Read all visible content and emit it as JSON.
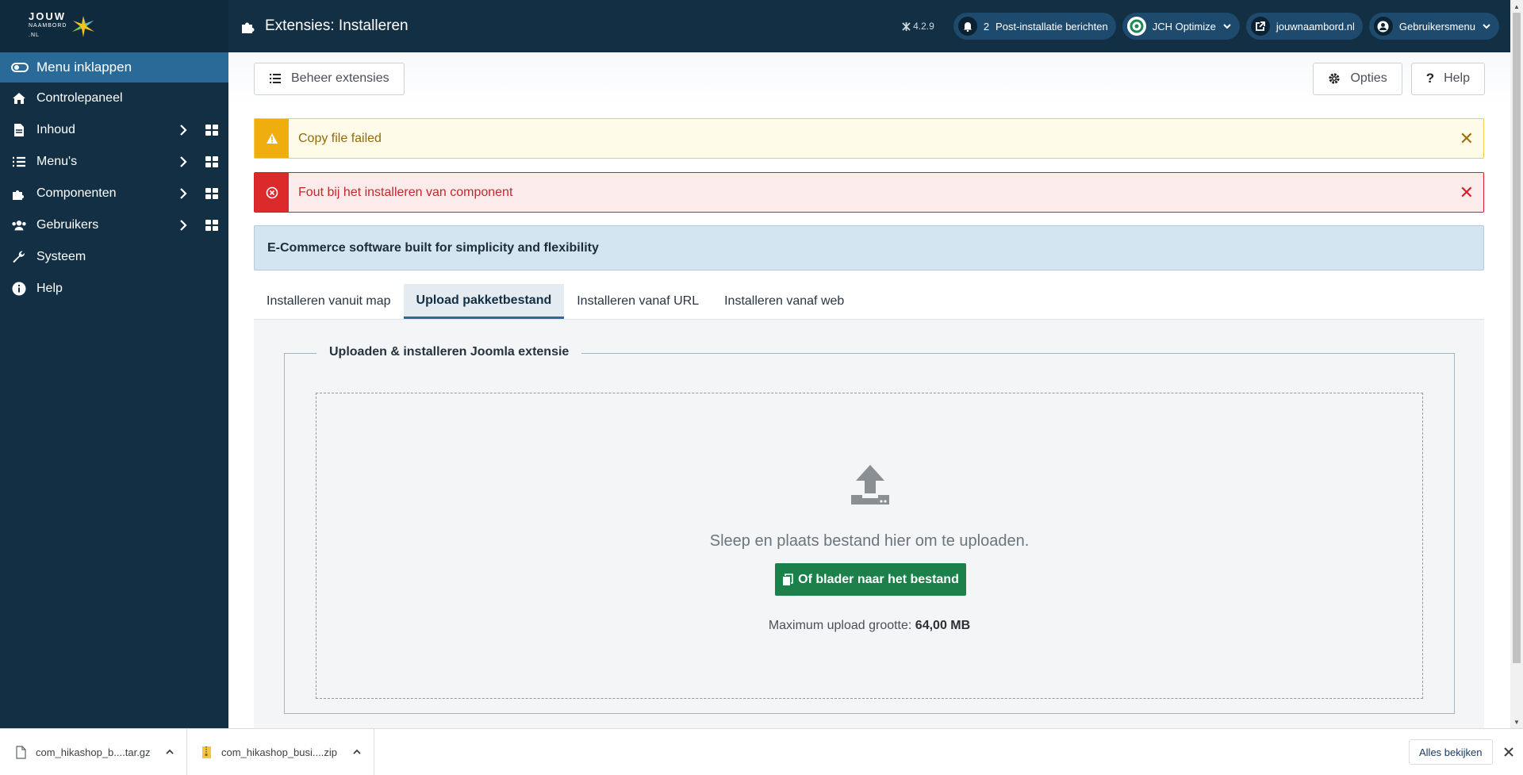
{
  "sidebar": {
    "logo": {
      "line1": "JOUW",
      "line2": "NAAMBORD",
      "line3": ".NL"
    },
    "toggle_label": "Menu inklappen",
    "items": [
      {
        "label": "Controlepaneel",
        "icon": "home-icon"
      },
      {
        "label": "Inhoud",
        "icon": "file-icon"
      },
      {
        "label": "Menu's",
        "icon": "list-icon"
      },
      {
        "label": "Componenten",
        "icon": "puzzle-icon"
      },
      {
        "label": "Gebruikers",
        "icon": "users-icon"
      },
      {
        "label": "Systeem",
        "icon": "wrench-icon"
      },
      {
        "label": "Help",
        "icon": "info-icon"
      }
    ]
  },
  "header": {
    "title": "Extensies: Installeren",
    "version": "4.2.9",
    "notifications": {
      "count": "2",
      "label": "Post-installatie berichten"
    },
    "jch_label": "JCH Optimize",
    "site_label": "jouwnaambord.nl",
    "user_menu_label": "Gebruikersmenu"
  },
  "toolbar": {
    "manage_label": "Beheer extensies",
    "options_label": "Opties",
    "help_label": "Help"
  },
  "alerts": {
    "warning": "Copy file failed",
    "error": "Fout bij het installeren van component",
    "info": "E-Commerce software built for simplicity and flexibility"
  },
  "tabs": [
    {
      "label": "Installeren vanuit map",
      "active": false
    },
    {
      "label": "Upload pakketbestand",
      "active": true
    },
    {
      "label": "Installeren vanaf URL",
      "active": false
    },
    {
      "label": "Installeren vanaf web",
      "active": false
    }
  ],
  "upload": {
    "legend": "Uploaden & installeren Joomla extensie",
    "drop_text": "Sleep en plaats bestand hier om te uploaden.",
    "browse_label": "Of blader naar het bestand",
    "max_label": "Maximum upload grootte:",
    "max_value": "64,00 MB"
  },
  "downloads": {
    "files": [
      {
        "name": "com_hikashop_b....tar.gz",
        "icon": "file-icon"
      },
      {
        "name": "com_hikashop_busi....zip",
        "icon": "zip-file-icon"
      }
    ],
    "see_all_label": "Alles bekijken"
  },
  "colors": {
    "sidebar_bg": "#132f44",
    "accent": "#2a6a98",
    "success": "#1b8049",
    "warning": "#f0ad0e",
    "danger": "#dc2a2a"
  }
}
